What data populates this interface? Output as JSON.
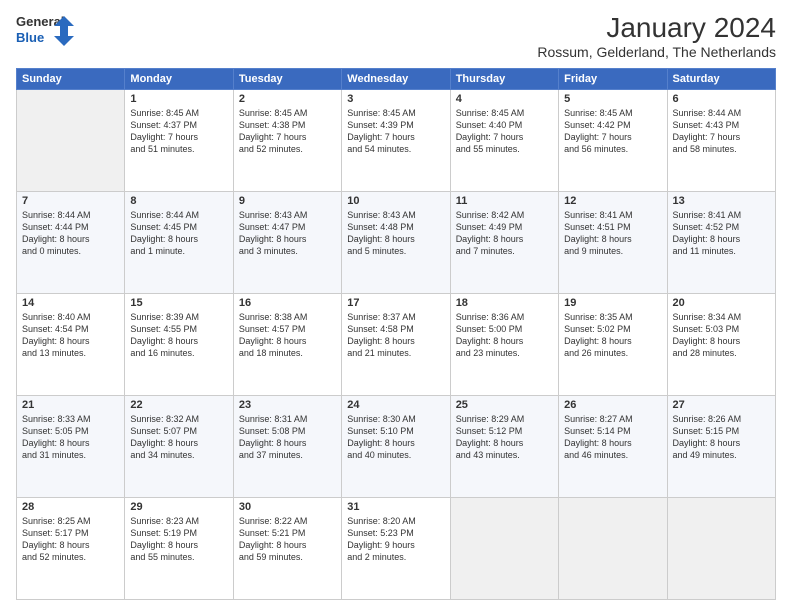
{
  "logo": {
    "line1": "General",
    "line2": "Blue"
  },
  "title": "January 2024",
  "location": "Rossum, Gelderland, The Netherlands",
  "days_header": [
    "Sunday",
    "Monday",
    "Tuesday",
    "Wednesday",
    "Thursday",
    "Friday",
    "Saturday"
  ],
  "weeks": [
    [
      {
        "day": "",
        "text": ""
      },
      {
        "day": "1",
        "text": "Sunrise: 8:45 AM\nSunset: 4:37 PM\nDaylight: 7 hours\nand 51 minutes."
      },
      {
        "day": "2",
        "text": "Sunrise: 8:45 AM\nSunset: 4:38 PM\nDaylight: 7 hours\nand 52 minutes."
      },
      {
        "day": "3",
        "text": "Sunrise: 8:45 AM\nSunset: 4:39 PM\nDaylight: 7 hours\nand 54 minutes."
      },
      {
        "day": "4",
        "text": "Sunrise: 8:45 AM\nSunset: 4:40 PM\nDaylight: 7 hours\nand 55 minutes."
      },
      {
        "day": "5",
        "text": "Sunrise: 8:45 AM\nSunset: 4:42 PM\nDaylight: 7 hours\nand 56 minutes."
      },
      {
        "day": "6",
        "text": "Sunrise: 8:44 AM\nSunset: 4:43 PM\nDaylight: 7 hours\nand 58 minutes."
      }
    ],
    [
      {
        "day": "7",
        "text": "Sunrise: 8:44 AM\nSunset: 4:44 PM\nDaylight: 8 hours\nand 0 minutes."
      },
      {
        "day": "8",
        "text": "Sunrise: 8:44 AM\nSunset: 4:45 PM\nDaylight: 8 hours\nand 1 minute."
      },
      {
        "day": "9",
        "text": "Sunrise: 8:43 AM\nSunset: 4:47 PM\nDaylight: 8 hours\nand 3 minutes."
      },
      {
        "day": "10",
        "text": "Sunrise: 8:43 AM\nSunset: 4:48 PM\nDaylight: 8 hours\nand 5 minutes."
      },
      {
        "day": "11",
        "text": "Sunrise: 8:42 AM\nSunset: 4:49 PM\nDaylight: 8 hours\nand 7 minutes."
      },
      {
        "day": "12",
        "text": "Sunrise: 8:41 AM\nSunset: 4:51 PM\nDaylight: 8 hours\nand 9 minutes."
      },
      {
        "day": "13",
        "text": "Sunrise: 8:41 AM\nSunset: 4:52 PM\nDaylight: 8 hours\nand 11 minutes."
      }
    ],
    [
      {
        "day": "14",
        "text": "Sunrise: 8:40 AM\nSunset: 4:54 PM\nDaylight: 8 hours\nand 13 minutes."
      },
      {
        "day": "15",
        "text": "Sunrise: 8:39 AM\nSunset: 4:55 PM\nDaylight: 8 hours\nand 16 minutes."
      },
      {
        "day": "16",
        "text": "Sunrise: 8:38 AM\nSunset: 4:57 PM\nDaylight: 8 hours\nand 18 minutes."
      },
      {
        "day": "17",
        "text": "Sunrise: 8:37 AM\nSunset: 4:58 PM\nDaylight: 8 hours\nand 21 minutes."
      },
      {
        "day": "18",
        "text": "Sunrise: 8:36 AM\nSunset: 5:00 PM\nDaylight: 8 hours\nand 23 minutes."
      },
      {
        "day": "19",
        "text": "Sunrise: 8:35 AM\nSunset: 5:02 PM\nDaylight: 8 hours\nand 26 minutes."
      },
      {
        "day": "20",
        "text": "Sunrise: 8:34 AM\nSunset: 5:03 PM\nDaylight: 8 hours\nand 28 minutes."
      }
    ],
    [
      {
        "day": "21",
        "text": "Sunrise: 8:33 AM\nSunset: 5:05 PM\nDaylight: 8 hours\nand 31 minutes."
      },
      {
        "day": "22",
        "text": "Sunrise: 8:32 AM\nSunset: 5:07 PM\nDaylight: 8 hours\nand 34 minutes."
      },
      {
        "day": "23",
        "text": "Sunrise: 8:31 AM\nSunset: 5:08 PM\nDaylight: 8 hours\nand 37 minutes."
      },
      {
        "day": "24",
        "text": "Sunrise: 8:30 AM\nSunset: 5:10 PM\nDaylight: 8 hours\nand 40 minutes."
      },
      {
        "day": "25",
        "text": "Sunrise: 8:29 AM\nSunset: 5:12 PM\nDaylight: 8 hours\nand 43 minutes."
      },
      {
        "day": "26",
        "text": "Sunrise: 8:27 AM\nSunset: 5:14 PM\nDaylight: 8 hours\nand 46 minutes."
      },
      {
        "day": "27",
        "text": "Sunrise: 8:26 AM\nSunset: 5:15 PM\nDaylight: 8 hours\nand 49 minutes."
      }
    ],
    [
      {
        "day": "28",
        "text": "Sunrise: 8:25 AM\nSunset: 5:17 PM\nDaylight: 8 hours\nand 52 minutes."
      },
      {
        "day": "29",
        "text": "Sunrise: 8:23 AM\nSunset: 5:19 PM\nDaylight: 8 hours\nand 55 minutes."
      },
      {
        "day": "30",
        "text": "Sunrise: 8:22 AM\nSunset: 5:21 PM\nDaylight: 8 hours\nand 59 minutes."
      },
      {
        "day": "31",
        "text": "Sunrise: 8:20 AM\nSunset: 5:23 PM\nDaylight: 9 hours\nand 2 minutes."
      },
      {
        "day": "",
        "text": ""
      },
      {
        "day": "",
        "text": ""
      },
      {
        "day": "",
        "text": ""
      }
    ]
  ]
}
